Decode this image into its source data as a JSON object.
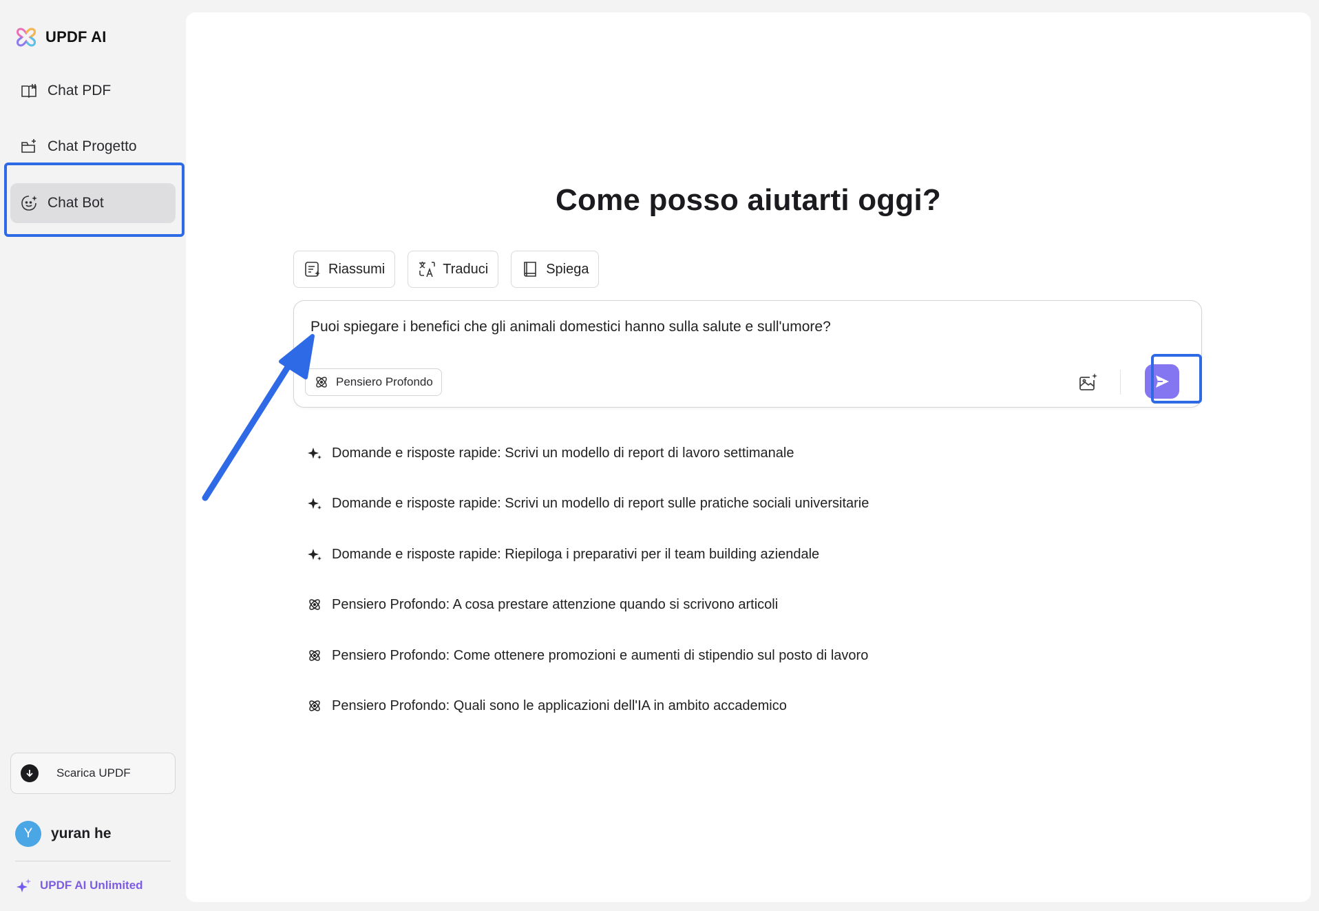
{
  "app": {
    "logo_text": "UPDF AI"
  },
  "sidebar": {
    "items": [
      {
        "label": "Chat PDF",
        "icon": "book-icon"
      },
      {
        "label": "Chat Progetto",
        "icon": "folder-plus-icon"
      },
      {
        "label": "Chat Bot",
        "icon": "bot-face-icon",
        "active": true
      }
    ],
    "download_label": "Scarica UPDF",
    "user": {
      "initial": "Y",
      "name": "yuran he"
    },
    "unlimited_label": "UPDF AI Unlimited"
  },
  "main": {
    "title": "Come posso aiutarti oggi?",
    "chips": [
      {
        "label": "Riassumi",
        "icon": "summarize-icon"
      },
      {
        "label": "Traduci",
        "icon": "translate-icon"
      },
      {
        "label": "Spiega",
        "icon": "book-open-icon"
      }
    ],
    "composer": {
      "value": "Puoi spiegare i benefici che gli animali domestici hanno sulla salute e sull'umore?",
      "deep_label": "Pensiero Profondo"
    },
    "suggestions": [
      {
        "text": "Domande e risposte rapide: Scrivi un modello di report di lavoro settimanale",
        "icon": "sparkle-icon"
      },
      {
        "text": "Domande e risposte rapide: Scrivi un modello di report sulle pratiche sociali universitarie",
        "icon": "sparkle-icon"
      },
      {
        "text": "Domande e risposte rapide: Riepiloga i preparativi per il team building aziendale",
        "icon": "sparkle-icon"
      },
      {
        "text": "Pensiero Profondo: A cosa prestare attenzione quando si scrivono articoli",
        "icon": "atom-icon"
      },
      {
        "text": "Pensiero Profondo: Come ottenere promozioni e aumenti di stipendio sul posto di lavoro",
        "icon": "atom-icon"
      },
      {
        "text": "Pensiero Profondo: Quali sono le applicazioni dell'IA in ambito accademico",
        "icon": "atom-icon"
      }
    ]
  },
  "colors": {
    "accent": "#8475f0",
    "annotation": "#2f6ae6",
    "sidebar_active": "#dedee0",
    "unlimited": "#7c5ce0"
  }
}
